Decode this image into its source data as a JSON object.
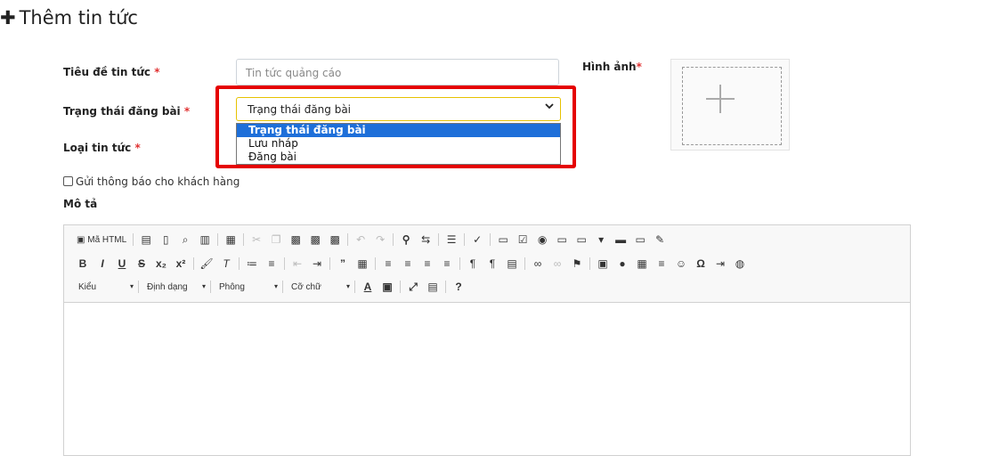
{
  "page_title": "Thêm tin tức",
  "form": {
    "title_label": "Tiêu đề tin tức",
    "required_mark": "*",
    "title_placeholder": "Tin tức quảng cáo",
    "status_label": "Trạng thái đăng bài",
    "status_selected": "Trạng thái đăng bài",
    "status_options": [
      "Trạng thái đăng bài",
      "Lưu nháp",
      "Đăng bài"
    ],
    "type_label": "Loại tin tức",
    "image_label": "Hình ảnh",
    "notify_label": "Gửi thông báo cho khách hàng",
    "description_label": "Mô tả"
  },
  "editor": {
    "source_label": "Mã HTML",
    "style_combo": "Kiểu",
    "format_combo": "Định dạng",
    "font_combo": "Phông",
    "size_combo": "Cỡ chữ"
  },
  "colors": {
    "highlight_border": "#e50000",
    "selected_option": "#1e6fd9",
    "required": "#e03131"
  }
}
